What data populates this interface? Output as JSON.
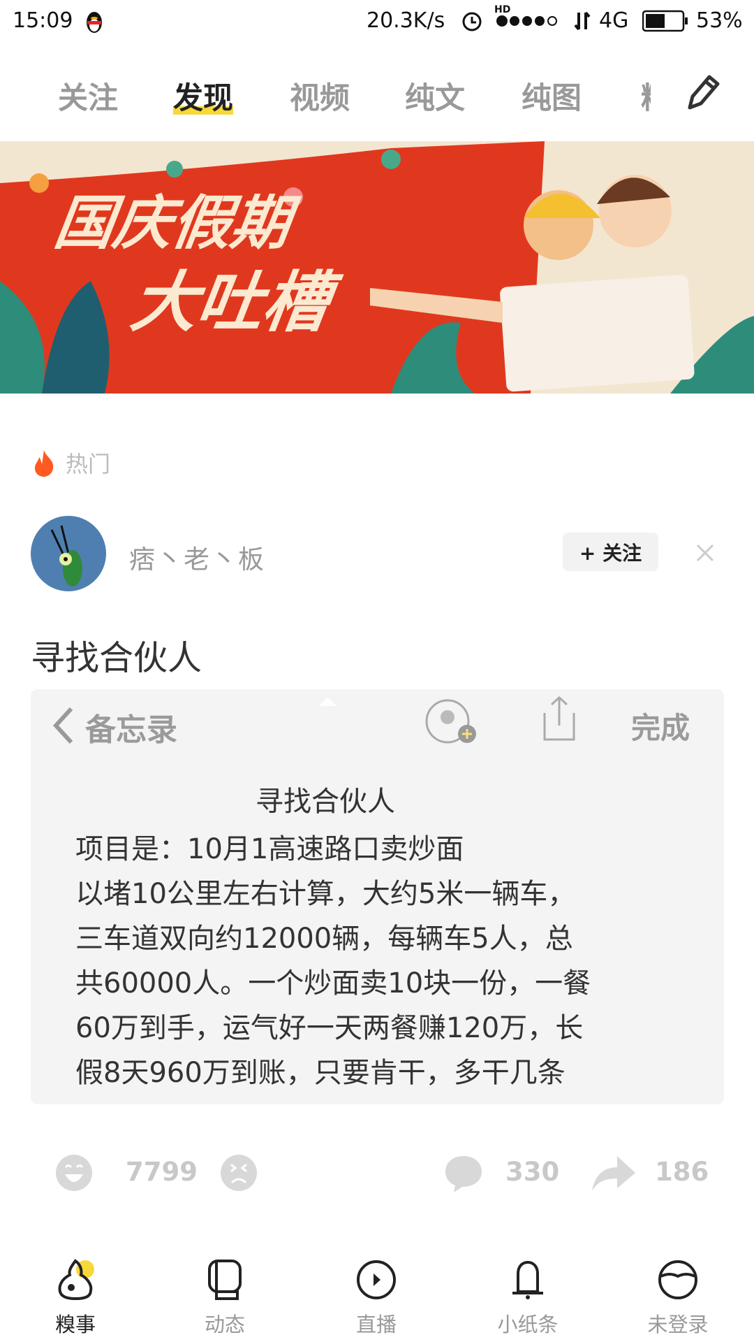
{
  "status_bar": {
    "time": "15:09",
    "net_speed": "20.3K/s",
    "network": "4G",
    "hd": "HD",
    "battery": "53%",
    "battery_level": 0.53
  },
  "tabs": [
    {
      "label": "关注"
    },
    {
      "label": "发现",
      "active": true
    },
    {
      "label": "视频"
    },
    {
      "label": "纯文"
    },
    {
      "label": "纯图"
    },
    {
      "label": "精"
    }
  ],
  "banner": {
    "line1": "国庆假期",
    "line2": "大吐槽"
  },
  "section": {
    "label": "热门"
  },
  "post": {
    "author": "痞丶老丶板",
    "follow_label": "+ 关注",
    "title": "寻找合伙人",
    "image": {
      "back_label": "备忘录",
      "done_label": "完成",
      "heading": "寻找合伙人",
      "lines": [
        "项目是：10月1高速路口卖炒面",
        "以堵10公里左右计算，大约5米一辆车，",
        "三车道双向约12000辆，每辆车5人，总",
        "共60000人。一个炒面卖10块一份，一餐",
        "60万到手，运气好一天两餐赚120万，长",
        "假8天960万到账，只要肯干，多干几条"
      ]
    },
    "likes": "7799",
    "comments": "330",
    "shares": "186"
  },
  "bottom_nav": [
    {
      "label": "糗事",
      "active": true
    },
    {
      "label": "动态"
    },
    {
      "label": "直播"
    },
    {
      "label": "小纸条"
    },
    {
      "label": "未登录"
    }
  ],
  "colors": {
    "accent": "#f8d838",
    "flame": "#ff5a1f",
    "banner_red": "#e0381e"
  }
}
